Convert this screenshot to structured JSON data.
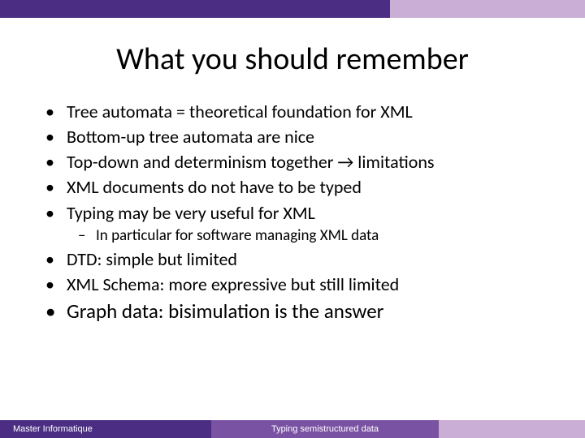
{
  "title": "What you should remember",
  "bullets": {
    "b0": "Tree automata = theoretical foundation for XML",
    "b1": "Bottom-up tree automata are nice",
    "b2": "Top-down and determinism together → limitations",
    "b3": "XML documents do not have to be typed",
    "b4": "Typing may be very useful for XML",
    "s4_0": "In particular  for software managing XML data",
    "b5": "DTD: simple but limited",
    "b6": "XML Schema: more expressive but still limited",
    "b7": "Graph data: bisimulation is the answer"
  },
  "footer": {
    "left": "Master Informatique",
    "mid": "Typing semistructured data"
  }
}
